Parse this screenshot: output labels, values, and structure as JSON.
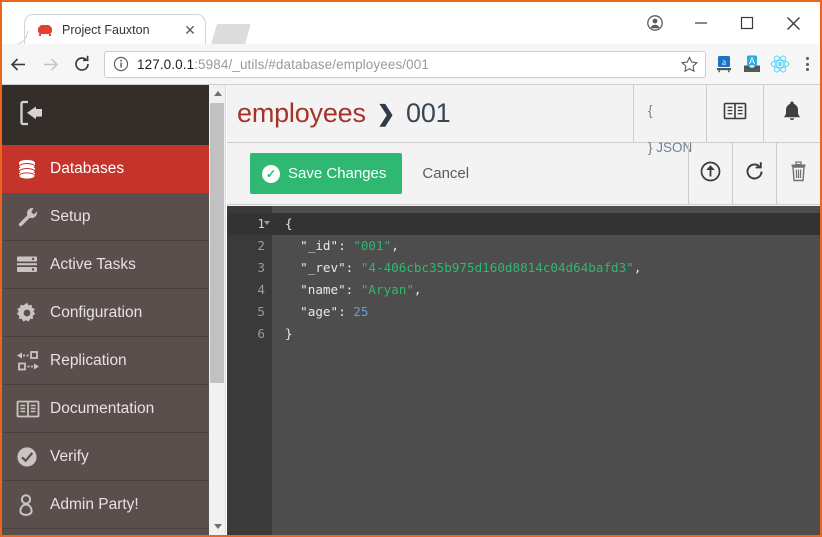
{
  "browser": {
    "tab": {
      "title": "Project Fauxton",
      "favicon": "couch-icon",
      "close_label": "✕"
    },
    "new_tab_label": "",
    "window_controls": {
      "profile": "profile-icon",
      "minimize": "—",
      "maximize": "□",
      "close": "✕"
    },
    "nav": {
      "back": "back-arrow-icon",
      "forward": "forward-arrow-icon",
      "reload": "reload-icon"
    },
    "omnibox": {
      "info_icon": "info-circle-icon",
      "url_host": "127.0.0.1",
      "url_rest": ":5984/_utils/#database/employees/001",
      "url_full": "127.0.0.1:5984/_utils/#database/employees/001",
      "star": "star-icon"
    },
    "extensions": [
      "amazon-assistant-icon",
      "evernote-clipper-icon",
      "react-devtools-icon"
    ],
    "menu": "three-dots-menu-icon"
  },
  "sidebar": {
    "collapse_icon": "collapse-sidebar-icon",
    "items": [
      {
        "label": "Databases",
        "icon": "database-icon",
        "active": true
      },
      {
        "label": "Setup",
        "icon": "wrench-icon",
        "active": false
      },
      {
        "label": "Active Tasks",
        "icon": "tasks-icon",
        "active": false
      },
      {
        "label": "Configuration",
        "icon": "gear-icon",
        "active": false
      },
      {
        "label": "Replication",
        "icon": "replication-icon",
        "active": false
      },
      {
        "label": "Documentation",
        "icon": "book-icon",
        "active": false
      },
      {
        "label": "Verify",
        "icon": "check-circle-icon",
        "active": false
      },
      {
        "label": "Admin Party!",
        "icon": "person-icon",
        "active": false
      }
    ]
  },
  "header": {
    "breadcrumb": {
      "database": "employees",
      "separator": "❯",
      "document": "001"
    },
    "json_toggle": {
      "brace_open": "{",
      "brace_close": "} JSON"
    },
    "actions": [
      {
        "name": "documentation-button",
        "icon": "book-icon"
      },
      {
        "name": "notifications-button",
        "icon": "bell-icon"
      }
    ]
  },
  "subheader": {
    "save_label": "Save Changes",
    "save_check": "✓",
    "cancel_label": "Cancel",
    "actions": [
      {
        "name": "upload-attachment-button",
        "icon": "upload-circle-icon"
      },
      {
        "name": "refresh-button",
        "icon": "refresh-icon"
      },
      {
        "name": "delete-button",
        "icon": "trash-icon"
      }
    ]
  },
  "editor": {
    "line_numbers": [
      "1",
      "2",
      "3",
      "4",
      "5",
      "6"
    ],
    "active_line": 1,
    "document": {
      "_id": "001",
      "_rev": "4-406cbc35b975d160d8814c04d64bafd3",
      "name": "Aryan",
      "age": 25
    },
    "lines": [
      {
        "num": "1",
        "text": "{"
      },
      {
        "num": "2",
        "text": "    \"_id\": \"001\","
      },
      {
        "num": "3",
        "text": "    \"_rev\": \"4-406cbc35b975d160d8814c04d64bafd3\","
      },
      {
        "num": "4",
        "text": "    \"name\": \"Aryan\","
      },
      {
        "num": "5",
        "text": "    \"age\": 25"
      },
      {
        "num": "6",
        "text": "}"
      }
    ],
    "tokens": {
      "l1": "{",
      "l2_key": "\"_id\"",
      "l2_val": "\"001\"",
      "l3_key": "\"_rev\"",
      "l3_val": "\"4-406cbc35b975d160d8814c04d64bafd3\"",
      "l4_key": "\"name\"",
      "l4_val": "\"Aryan\"",
      "l5_key": "\"age\"",
      "l5_val": "25",
      "l6": "}",
      "colon": ": ",
      "comma": ","
    }
  },
  "colors": {
    "window_border": "#e8661e",
    "sidebar_bg": "#5a4f4c",
    "sidebar_top_bg": "#342e2b",
    "sidebar_active": "#c5342a",
    "breadcrumb_db": "#a5332a",
    "save_green": "#2eb872",
    "editor_bg": "#4d4d4d",
    "gutter_bg": "#3a3a3a",
    "string_green": "#2eb872",
    "number_blue": "#6b9fd4"
  }
}
